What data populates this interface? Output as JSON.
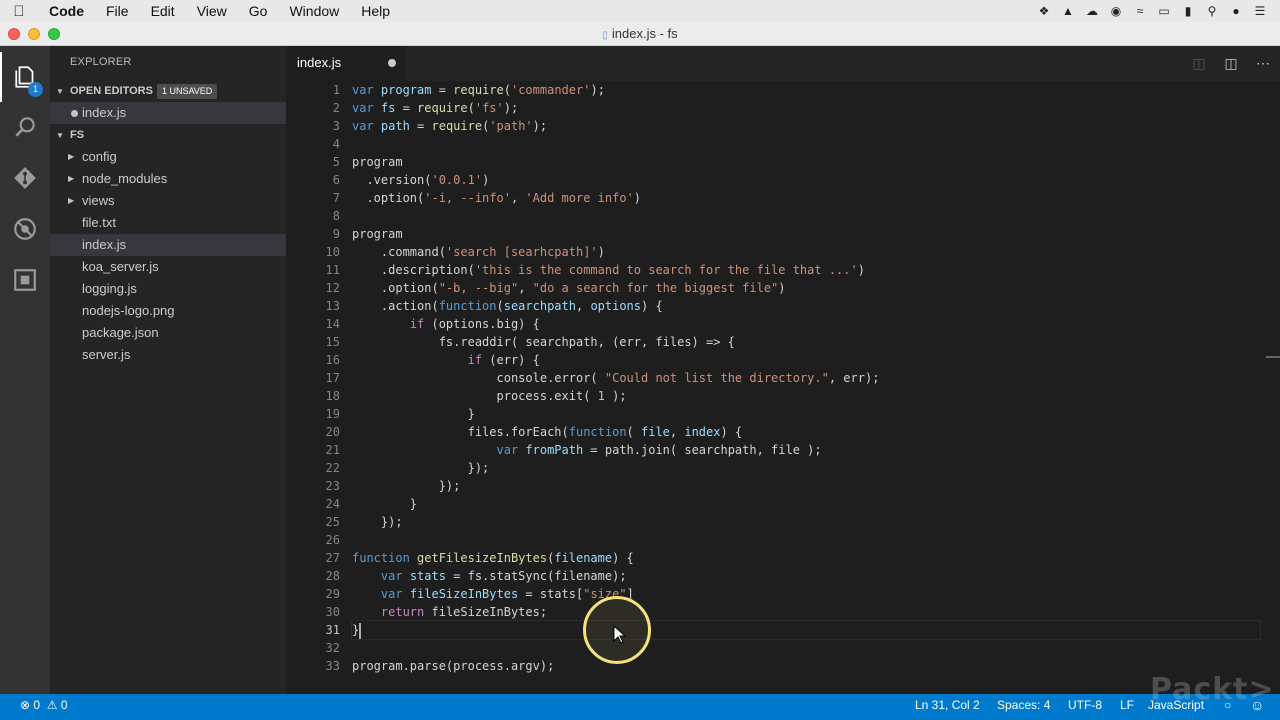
{
  "menubar": {
    "app": "Code",
    "items": [
      "File",
      "Edit",
      "View",
      "Go",
      "Window",
      "Help"
    ],
    "tray_icons": [
      "dropbox-icon",
      "alert-icon",
      "creative-cloud-icon",
      "record-icon",
      "wifi-icon",
      "airplay-icon",
      "battery-icon",
      "spotlight-icon",
      "user-icon",
      "list-icon"
    ]
  },
  "window": {
    "title": "index.js - fs"
  },
  "activity": {
    "explorer_badge": "1"
  },
  "sidebar": {
    "title": "EXPLORER",
    "open_editors": {
      "label": "OPEN EDITORS",
      "badge": "1 UNSAVED",
      "files": [
        "index.js"
      ]
    },
    "folder": {
      "label": "FS"
    },
    "tree": [
      {
        "name": "config",
        "type": "folder"
      },
      {
        "name": "node_modules",
        "type": "folder"
      },
      {
        "name": "views",
        "type": "folder"
      },
      {
        "name": "file.txt",
        "type": "file"
      },
      {
        "name": "index.js",
        "type": "file",
        "selected": true
      },
      {
        "name": "koa_server.js",
        "type": "file"
      },
      {
        "name": "logging.js",
        "type": "file"
      },
      {
        "name": "nodejs-logo.png",
        "type": "file"
      },
      {
        "name": "package.json",
        "type": "file"
      },
      {
        "name": "server.js",
        "type": "file"
      }
    ]
  },
  "tabs": [
    {
      "label": "index.js",
      "dirty": true
    }
  ],
  "editor": {
    "line_numbers": [
      "1",
      "2",
      "3",
      "4",
      "5",
      "6",
      "7",
      "8",
      "9",
      "10",
      "11",
      "12",
      "13",
      "14",
      "15",
      "16",
      "17",
      "18",
      "19",
      "20",
      "21",
      "22",
      "23",
      "24",
      "25",
      "26",
      "27",
      "28",
      "29",
      "30",
      "31",
      "32",
      "33"
    ],
    "current_line": 31,
    "lines": [
      [
        [
          "kw",
          "var "
        ],
        [
          "id",
          "program"
        ],
        [
          "plain",
          " = "
        ],
        [
          "fn",
          "require"
        ],
        [
          "plain",
          "("
        ],
        [
          "str",
          "'commander'"
        ],
        [
          "plain",
          ");"
        ]
      ],
      [
        [
          "kw",
          "var "
        ],
        [
          "id",
          "fs"
        ],
        [
          "plain",
          " = "
        ],
        [
          "fn",
          "require"
        ],
        [
          "plain",
          "("
        ],
        [
          "str",
          "'fs'"
        ],
        [
          "plain",
          ");"
        ]
      ],
      [
        [
          "kw",
          "var "
        ],
        [
          "id",
          "path"
        ],
        [
          "plain",
          " = "
        ],
        [
          "fn",
          "require"
        ],
        [
          "plain",
          "("
        ],
        [
          "str",
          "'path'"
        ],
        [
          "plain",
          ");"
        ]
      ],
      [],
      [
        [
          "plain",
          "program"
        ]
      ],
      [
        [
          "plain",
          "  .version("
        ],
        [
          "str",
          "'0.0.1'"
        ],
        [
          "plain",
          ")"
        ]
      ],
      [
        [
          "plain",
          "  .option("
        ],
        [
          "str",
          "'-i, --info'"
        ],
        [
          "plain",
          ", "
        ],
        [
          "str",
          "'Add more info'"
        ],
        [
          "plain",
          ")"
        ]
      ],
      [],
      [
        [
          "plain",
          "program"
        ]
      ],
      [
        [
          "plain",
          "    .command("
        ],
        [
          "str",
          "'search [searhcpath]'"
        ],
        [
          "plain",
          ")"
        ]
      ],
      [
        [
          "plain",
          "    .description("
        ],
        [
          "str",
          "'this is the command to search for the file that ...'"
        ],
        [
          "plain",
          ")"
        ]
      ],
      [
        [
          "plain",
          "    .option("
        ],
        [
          "str",
          "\"-b, --big\""
        ],
        [
          "plain",
          ", "
        ],
        [
          "str",
          "\"do a search for the biggest file\""
        ],
        [
          "plain",
          ")"
        ]
      ],
      [
        [
          "plain",
          "    .action("
        ],
        [
          "kw",
          "function"
        ],
        [
          "plain",
          "("
        ],
        [
          "id",
          "searchpath"
        ],
        [
          "plain",
          ", "
        ],
        [
          "id",
          "options"
        ],
        [
          "plain",
          ") {"
        ]
      ],
      [
        [
          "plain",
          "        "
        ],
        [
          "ctl",
          "if"
        ],
        [
          "plain",
          " (options.big) {"
        ]
      ],
      [
        [
          "plain",
          "            fs.readdir( searchpath, (err, files) => {"
        ]
      ],
      [
        [
          "plain",
          "                "
        ],
        [
          "ctl",
          "if"
        ],
        [
          "plain",
          " (err) {"
        ]
      ],
      [
        [
          "plain",
          "                    console.error( "
        ],
        [
          "str",
          "\"Could not list the directory.\""
        ],
        [
          "plain",
          ", err);"
        ]
      ],
      [
        [
          "plain",
          "                    process.exit( "
        ],
        [
          "num",
          "1"
        ],
        [
          "plain",
          " );"
        ]
      ],
      [
        [
          "plain",
          "                }"
        ]
      ],
      [
        [
          "plain",
          "                files.forEach("
        ],
        [
          "kw",
          "function"
        ],
        [
          "plain",
          "( "
        ],
        [
          "id",
          "file"
        ],
        [
          "plain",
          ", "
        ],
        [
          "id",
          "index"
        ],
        [
          "plain",
          ") {"
        ]
      ],
      [
        [
          "plain",
          "                    "
        ],
        [
          "kw",
          "var "
        ],
        [
          "id",
          "fromPath"
        ],
        [
          "plain",
          " = path.join( searchpath, file );"
        ]
      ],
      [
        [
          "plain",
          "                });"
        ]
      ],
      [
        [
          "plain",
          "            });"
        ]
      ],
      [
        [
          "plain",
          "        }"
        ]
      ],
      [
        [
          "plain",
          "    });"
        ]
      ],
      [],
      [
        [
          "kw",
          "function "
        ],
        [
          "fn",
          "getFilesizeInBytes"
        ],
        [
          "plain",
          "("
        ],
        [
          "id",
          "filename"
        ],
        [
          "plain",
          ") {"
        ]
      ],
      [
        [
          "plain",
          "    "
        ],
        [
          "kw",
          "var "
        ],
        [
          "id",
          "stats"
        ],
        [
          "plain",
          " = fs.statSync(filename);"
        ]
      ],
      [
        [
          "plain",
          "    "
        ],
        [
          "kw",
          "var "
        ],
        [
          "id",
          "fileSizeInBytes"
        ],
        [
          "plain",
          " = stats["
        ],
        [
          "str",
          "\"size\""
        ],
        [
          "plain",
          "]"
        ]
      ],
      [
        [
          "plain",
          "    "
        ],
        [
          "ctl",
          "return"
        ],
        [
          "plain",
          " fileSizeInBytes;"
        ]
      ],
      [
        [
          "plain",
          "}"
        ]
      ],
      [],
      [
        [
          "plain",
          "program.parse(process.argv);"
        ]
      ]
    ]
  },
  "statusbar": {
    "errors": "0",
    "warnings": "0",
    "position": "Ln 31, Col 2",
    "spaces": "Spaces: 4",
    "encoding": "UTF-8",
    "eol": "LF",
    "language": "JavaScript"
  },
  "watermark": "Packt>",
  "colors": {
    "statusbar": "#007acc",
    "keyword": "#569cd6",
    "string": "#ce9178",
    "function": "#dcdcaa",
    "control": "#c586c0"
  }
}
